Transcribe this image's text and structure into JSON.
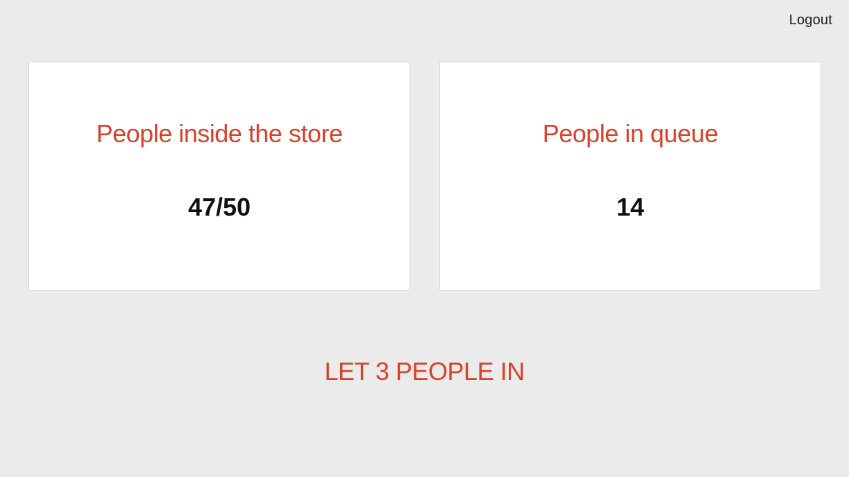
{
  "header": {
    "logout_label": "Logout"
  },
  "cards": [
    {
      "title": "People inside the store",
      "value": "47/50"
    },
    {
      "title": "People in queue",
      "value": "14"
    }
  ],
  "action": {
    "label": "LET 3 PEOPLE IN"
  },
  "colors": {
    "background": "#ebebeb",
    "accent": "#d9412a",
    "card_background": "#ffffff",
    "text": "#111111"
  }
}
